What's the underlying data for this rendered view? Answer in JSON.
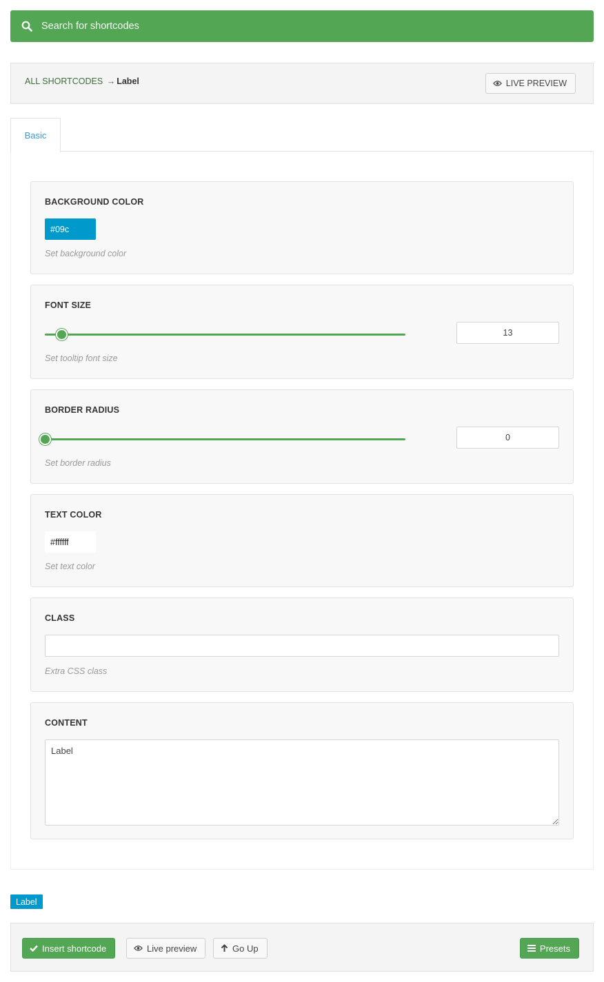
{
  "search": {
    "placeholder": "Search for shortcodes",
    "icon": "search-icon"
  },
  "header": {
    "breadcrumb_root": "ALL SHORTCODES",
    "breadcrumb_arrow": "→",
    "breadcrumb_current": "Label",
    "live_preview_label": "LIVE PREVIEW"
  },
  "tabs": [
    {
      "label": "Basic",
      "active": true
    }
  ],
  "fields": {
    "background_color": {
      "title": "BACKGROUND COLOR",
      "value": "#09c",
      "description": "Set background color",
      "swatch_color": "#0099cc"
    },
    "font_size": {
      "title": "FONT SIZE",
      "value": "13",
      "slider_fraction": 0.05,
      "description": "Set tooltip font size"
    },
    "border_radius": {
      "title": "BORDER RADIUS",
      "value": "0",
      "slider_fraction": 0.0,
      "description": "Set border radius"
    },
    "text_color": {
      "title": "TEXT COLOR",
      "value": "#ffffff",
      "description": "Set text color"
    },
    "class": {
      "title": "CLASS",
      "value": "",
      "description": "Extra CSS class"
    },
    "content": {
      "title": "CONTENT",
      "value": "Label"
    }
  },
  "preview": {
    "label": "Label"
  },
  "footer": {
    "insert_label": "Insert shortcode",
    "live_preview_label": "Live preview",
    "go_up_label": "Go Up",
    "presets_label": "Presets"
  },
  "colors": {
    "accent_green": "#53a653",
    "preview_blue": "#0099cc",
    "tab_link": "#3a9ad9"
  }
}
